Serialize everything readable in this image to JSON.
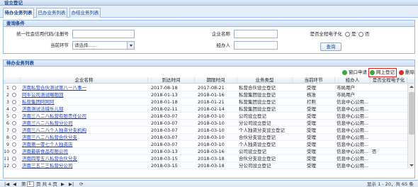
{
  "title": "设立登记",
  "tabs": [
    {
      "label": "待办业务列表"
    },
    {
      "label": "已办业务列表"
    },
    {
      "label": "办结业务列表"
    }
  ],
  "query": {
    "header": "查询条件",
    "credit_code_label": "统一社会信用代码/注册号",
    "credit_code_value": "",
    "company_name_label": "企业名称",
    "company_name_value": "",
    "full_e_label": "是否全程电子化",
    "radio_yes": "是",
    "radio_no": "否",
    "stage_label": "当前环节",
    "stage_value": "请选择......",
    "handler_label": "经办人",
    "handler_value": "",
    "search_button": "查询"
  },
  "list": {
    "header": "待办业务列表",
    "toolbar": {
      "window_apply": "窗口申请",
      "online_register": "网上登记",
      "delete": "删除"
    },
    "columns": [
      "企业名称",
      "到达时间",
      "期限时间",
      "业务类型",
      "当前环节",
      "经办人",
      "是否全程电子化"
    ],
    "rows": [
      {
        "no": "1",
        "name": "济南私营合伙测试第八一八事一",
        "arrive": "2017-08-18",
        "deadline": "2017-08-21",
        "type": "私营合伙设立登记",
        "stage": "受理",
        "handler": "市局用户",
        "elec": ""
      },
      {
        "no": "2",
        "name": "阿牛公司测试略限回",
        "arrive": "2018-01-13",
        "deadline": "2018-01-16",
        "type": "私营集团设立登记",
        "stage": "核准",
        "handler": "市局用户",
        "elec": ""
      },
      {
        "no": "3",
        "name": "私营集团阿阿阿",
        "arrive": "2018-01-18",
        "deadline": "2018-01-21",
        "type": "私营集团设立登记",
        "stage": "打照",
        "handler": "信息中心公用...",
        "elec": ""
      },
      {
        "no": "4",
        "name": "济南测试法城乐儿部",
        "arrive": "2018-02-11",
        "deadline": "2018-02-14",
        "type": "私营集团设立登记",
        "stage": "受理",
        "handler": "信息中心公用...",
        "elec": ""
      },
      {
        "no": "5",
        "name": "济南三八二八私营有限责任公司",
        "arrive": "2018-03-07",
        "deadline": "2018-03-10",
        "type": "公司设立登记",
        "stage": "受理",
        "handler": "信息中心公用...",
        "elec": ""
      },
      {
        "no": "6",
        "name": "济南三八二八私营分公司",
        "arrive": "2018-03-07",
        "deadline": "2018-03-10",
        "type": "分公司设立登记",
        "stage": "受理",
        "handler": "信息中心公用...",
        "elec": ""
      },
      {
        "no": "7",
        "name": "济南三八二八个人独资分支机构",
        "arrive": "2018-03-07",
        "deadline": "2018-03-10",
        "type": "个人独资分支设立登记",
        "stage": "受理",
        "handler": "信息中心公用...",
        "elec": ""
      },
      {
        "no": "8",
        "name": "济南三八二八私营合伙分支",
        "arrive": "2018-03-07",
        "deadline": "2018-03-10",
        "type": "合伙分支设立登记",
        "stage": "受理",
        "handler": "信息中心公用...",
        "elec": ""
      },
      {
        "no": "9",
        "name": "济南第一零七个人独资店",
        "arrive": "2018-03-07",
        "deadline": "2018-03-10",
        "type": "个人独资设立登记",
        "stage": "受理",
        "handler": "信息中心公用...",
        "elec": ""
      },
      {
        "no": "10",
        "name": "济南最新食品有限公司",
        "arrive": "2018-03-13",
        "deadline": "2018-03-16",
        "type": "公司设立登记",
        "stage": "受理",
        "handler": "信息中心公用...",
        "elec": "否"
      },
      {
        "no": "11",
        "name": "济南四零五八私营合伙分支",
        "arrive": "2018-03-15",
        "deadline": "2018-03-18",
        "type": "合伙分支设立登记",
        "stage": "受理",
        "handler": "信息中心公用...",
        "elec": ""
      },
      {
        "no": "12",
        "name": "济南三五二三私营分公司",
        "arrive": "2018-03-15",
        "deadline": "2018-03-18",
        "type": "分公司设立登记",
        "stage": "受理",
        "handler": "信息中心公用...",
        "elec": ""
      }
    ]
  },
  "pager": {
    "page_prefix": "第",
    "page_value": "1",
    "page_suffix": "页 共 4 页",
    "summary": "显示 1 - 20，共 65 条"
  },
  "colors": {
    "accent": "#15428b",
    "link": "#1a3ccf",
    "highlight": "#e02020",
    "add_icon": "#3aa83a",
    "delete_icon": "#d92b2b"
  }
}
